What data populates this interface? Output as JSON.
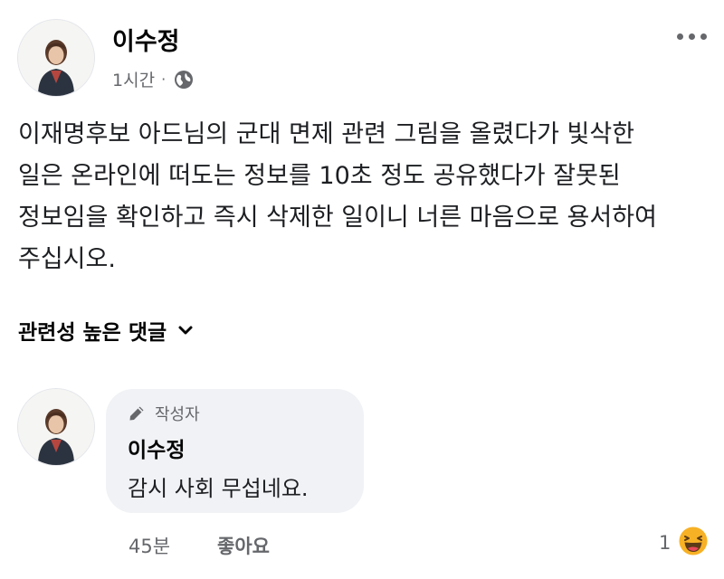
{
  "post": {
    "author": "이수정",
    "time": "1시간",
    "separator": "·",
    "audience_icon": "globe-icon",
    "more_icon": "more-horizontal-icon",
    "body_lines": [
      "이재명후보 아드님의 군대 면제 관련 그림을 올렸다가 빛삭한",
      "일은 온라인에 떠도는 정보를 10초 정도 공유했다가 잘못된",
      "정보임을 확인하고 즉시 삭제한 일이니 너른 마음으로 용서하여",
      "주십시오."
    ]
  },
  "comments_header": {
    "sort_label": "관련성 높은 댓글",
    "sort_icon": "chevron-down-icon"
  },
  "comment": {
    "badge_icon": "pencil-icon",
    "badge_label": "작성자",
    "author": "이수정",
    "text": "감시 사회 무섭네요.",
    "time": "45분",
    "like_label": "좋아요",
    "reaction_count": "1",
    "reaction_icon": "haha-emoji-icon"
  },
  "colors": {
    "secondary_text": "#65676b",
    "bubble_bg": "#f0f2f5",
    "reaction_yellow": "#f7b125"
  }
}
